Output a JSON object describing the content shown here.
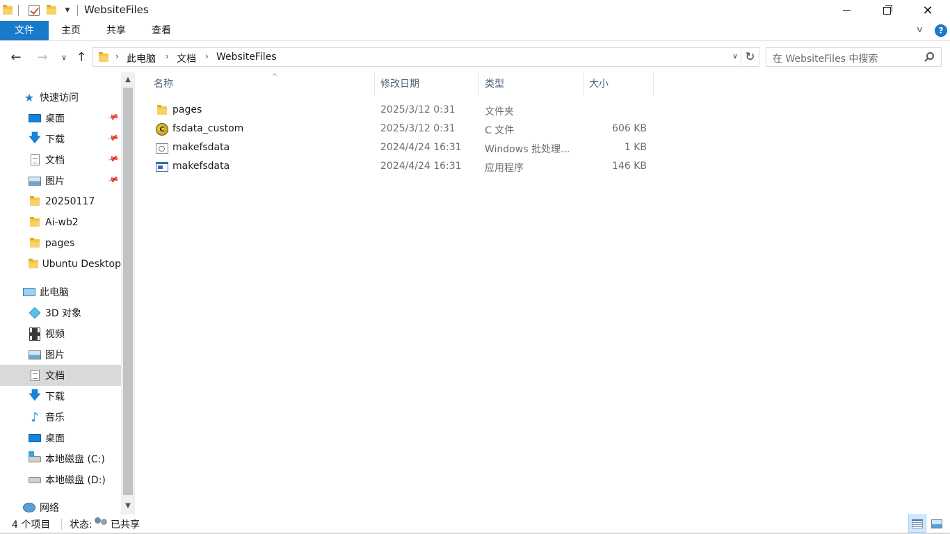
{
  "window": {
    "title": "WebsiteFiles"
  },
  "ribbon": {
    "tabs": [
      "文件",
      "主页",
      "共享",
      "查看"
    ]
  },
  "address": {
    "crumbs": [
      "此电脑",
      "文档",
      "WebsiteFiles"
    ]
  },
  "search": {
    "placeholder": "在 WebsiteFiles 中搜索"
  },
  "sidebar": {
    "quick_access": "快速访问",
    "quick_items": [
      "桌面",
      "下载",
      "文档",
      "图片",
      "20250117",
      "Ai-wb2",
      "pages",
      "Ubuntu Desktop"
    ],
    "this_pc": "此电脑",
    "pc_items": [
      "3D 对象",
      "视频",
      "图片",
      "文档",
      "下载",
      "音乐",
      "桌面",
      "本地磁盘 (C:)",
      "本地磁盘 (D:)"
    ],
    "network": "网络",
    "selected_item": "文档"
  },
  "columns": [
    "名称",
    "修改日期",
    "类型",
    "大小"
  ],
  "files": [
    {
      "name": "pages",
      "date": "2025/3/12 0:31",
      "type": "文件夹",
      "size": "",
      "icon": "folder-icon"
    },
    {
      "name": "fsdata_custom",
      "date": "2025/3/12 0:31",
      "type": "C 文件",
      "size": "606 KB",
      "icon": "c-file-icon"
    },
    {
      "name": "makefsdata",
      "date": "2024/4/24 16:31",
      "type": "Windows 批处理...",
      "size": "1 KB",
      "icon": "batch-file-icon"
    },
    {
      "name": "makefsdata",
      "date": "2024/4/24 16:31",
      "type": "应用程序",
      "size": "146 KB",
      "icon": "application-icon"
    }
  ],
  "status": {
    "count": "4 个项目",
    "label": "状态:",
    "value": "已共享"
  },
  "colors": {
    "accent": "#1979ca",
    "selected_bg": "#d9d9d9",
    "header_text": "#4c607a"
  }
}
